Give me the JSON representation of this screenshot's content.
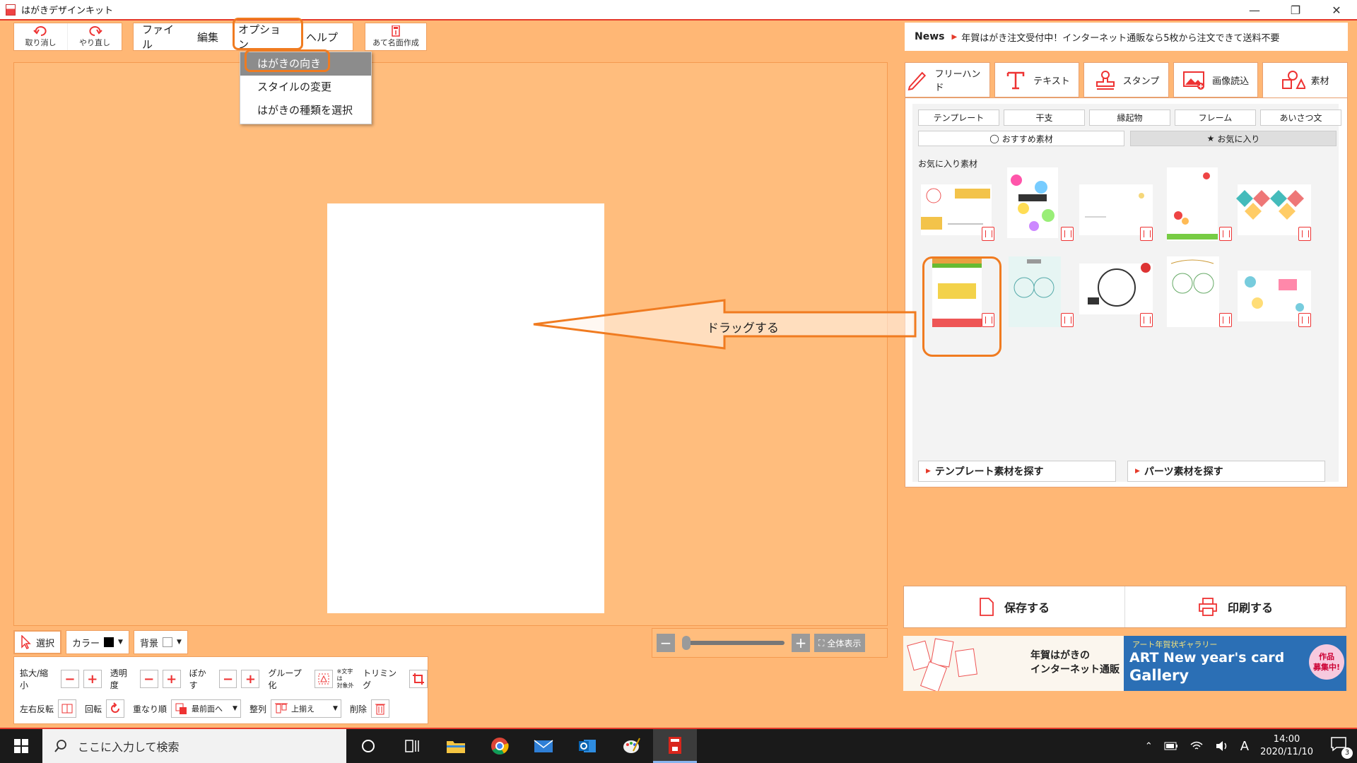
{
  "app": {
    "title": "はがきデザインキット"
  },
  "window_controls": {
    "minimize": "—",
    "restore": "❐",
    "close": "✕"
  },
  "toolbar": {
    "undo_label": "取り消し",
    "redo_label": "やり直し",
    "menu": [
      "ファイル",
      "編集",
      "オプション",
      "ヘルプ"
    ],
    "address_label": "あて名面作成"
  },
  "options_menu": {
    "items": [
      "はがきの向き",
      "スタイルの変更",
      "はがきの種類を選択"
    ],
    "active_index": 0
  },
  "annotation": {
    "drag_text": "ドラッグする"
  },
  "news": {
    "label": "News",
    "text": "年賀はがき注文受付中！インターネット通販なら5枚から注文できて送料不要"
  },
  "tool_tabs": [
    "フリーハンド",
    "テキスト",
    "スタンプ",
    "画像読込",
    "素材"
  ],
  "material": {
    "category_tabs": [
      "テンプレート",
      "干支",
      "縁起物",
      "フレーム",
      "あいさつ文"
    ],
    "sub_tabs": [
      "おすすめ素材",
      "お気に入り"
    ],
    "active_sub_tab": 1,
    "favorites_label": "お気に入り素材",
    "search_template": "テンプレート素材を探す",
    "search_parts": "パーツ素材を探す"
  },
  "actions": {
    "save": "保存する",
    "print": "印刷する"
  },
  "banners": {
    "left_line1": "年賀はがきの",
    "left_line2": "インターネット通販",
    "right_kicker": "アート年賀状ギャラリー",
    "right_title": "ART New year's card",
    "right_title2": "Gallery",
    "badge_line1": "作品",
    "badge_line2": "募集中!"
  },
  "zoom": {
    "fit_label": "全体表示"
  },
  "edit": {
    "select": "選択",
    "color": "カラー",
    "background": "背景",
    "scale": "拡大/縮小",
    "opacity": "透明度",
    "blur": "ぼかす",
    "group": "グループ化",
    "group_note1": "※文字は",
    "group_note2": "対象外",
    "trim": "トリミング",
    "flip": "左右反転",
    "rotate": "回転",
    "order": "重なり順",
    "order_value": "最前面へ",
    "align": "整列",
    "align_value": "上揃え",
    "delete": "削除"
  },
  "taskbar": {
    "search_placeholder": "ここに入力して検索",
    "time": "14:00",
    "date": "2020/11/10",
    "ime": "A",
    "notifications": "3"
  },
  "colors": {
    "accent": "#e53a2a",
    "highlight": "#f07b20",
    "canvas_bg": "#ffbd7d"
  }
}
